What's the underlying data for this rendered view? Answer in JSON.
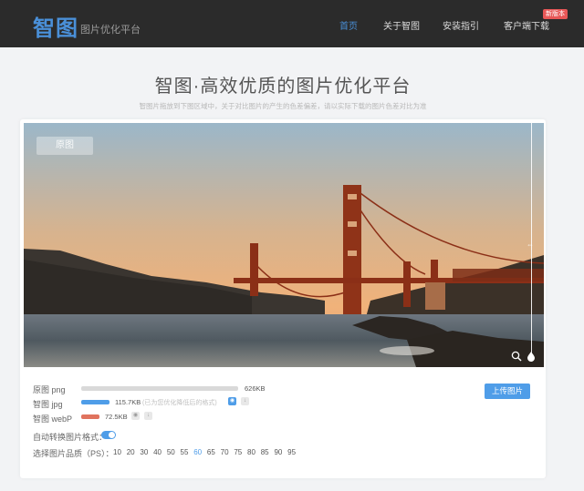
{
  "header": {
    "logo": "智图",
    "subtitle": "图片优化平台",
    "nav": [
      "首页",
      "关于智图",
      "安装指引",
      "客户端下载"
    ],
    "badge": "新版本"
  },
  "hero": {
    "title": "智图·高效优质的图片优化平台",
    "subtitle": "智图片拖放到下图区域中，关于对比图片的产生的色差偏差，请以实际下载的图片色差对比为准"
  },
  "preview": {
    "tag": "原图"
  },
  "results": {
    "png": {
      "label": "原图 png",
      "size": "626KB"
    },
    "jpg": {
      "label": "智图 jpg",
      "size": "115.7KB",
      "note": "(已为您优化降低后的格式)"
    },
    "webp": {
      "label": "智图 webP",
      "size": "72.5KB"
    },
    "upload": "上传图片"
  },
  "options": {
    "auto_convert": "自动转换图片格式：",
    "quality_label": "选择图片品质（PS）：",
    "quality_values": [
      "10",
      "20",
      "30",
      "40",
      "50",
      "55",
      "60",
      "65",
      "70",
      "75",
      "80",
      "85",
      "90",
      "95"
    ],
    "quality_selected": "60"
  },
  "colors": {
    "accent": "#4f9de8",
    "header_bg": "#2b2b2b",
    "badge": "#e85757",
    "webp_bar": "#e0735e"
  },
  "icons": {
    "zoom": "zoom-icon",
    "eye": "eye-icon",
    "download": "download-icon",
    "drop": "water-drop-icon"
  }
}
